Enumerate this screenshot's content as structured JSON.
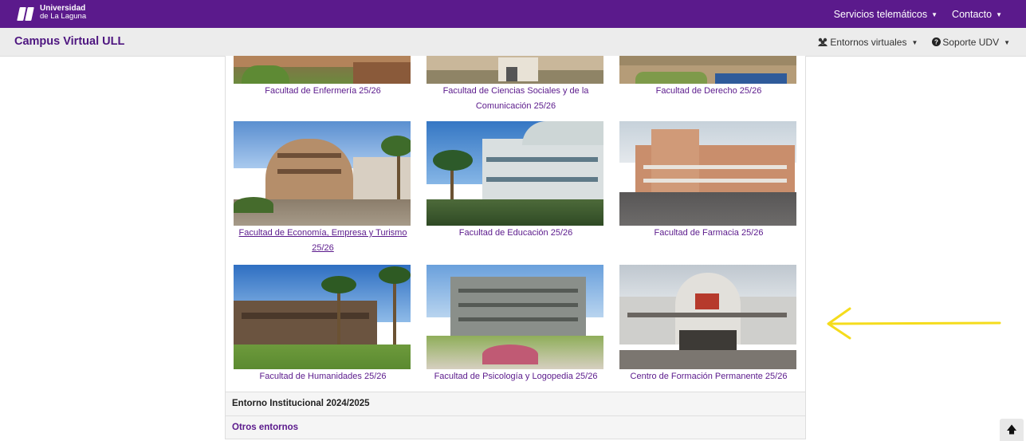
{
  "header": {
    "logo_line1": "Universidad",
    "logo_line2": "de La Laguna",
    "nav": [
      {
        "label": "Servicios telemáticos"
      },
      {
        "label": "Contacto"
      }
    ]
  },
  "subheader": {
    "brand": "Campus Virtual ULL",
    "nav": [
      {
        "icon": "users-icon",
        "label": "Entornos virtuales"
      },
      {
        "icon": "help-icon",
        "label": "Soporte UDV"
      }
    ]
  },
  "faculties": [
    {
      "caption": "Facultad de Enfermería 25/26"
    },
    {
      "caption": "Facultad de Ciencias Sociales y de la Comunicación 25/26"
    },
    {
      "caption": "Facultad de Derecho 25/26"
    },
    {
      "caption": "Facultad de Economía, Empresa y Turismo 25/26"
    },
    {
      "caption": "Facultad de Educación 25/26"
    },
    {
      "caption": "Facultad de Farmacia 25/26"
    },
    {
      "caption": "Facultad de Humanidades 25/26"
    },
    {
      "caption": "Facultad de Psicología y Logopedia 25/26"
    },
    {
      "caption": "Centro de Formación Permanente 25/26"
    }
  ],
  "sections": [
    {
      "label": "Entorno Institucional 2024/2025"
    },
    {
      "label": "Otros entornos"
    }
  ],
  "colors": {
    "primary": "#5b1a8c",
    "annotation_arrow": "#f5dc1c"
  },
  "icons": {
    "scroll_top": "arrow-up-icon"
  }
}
